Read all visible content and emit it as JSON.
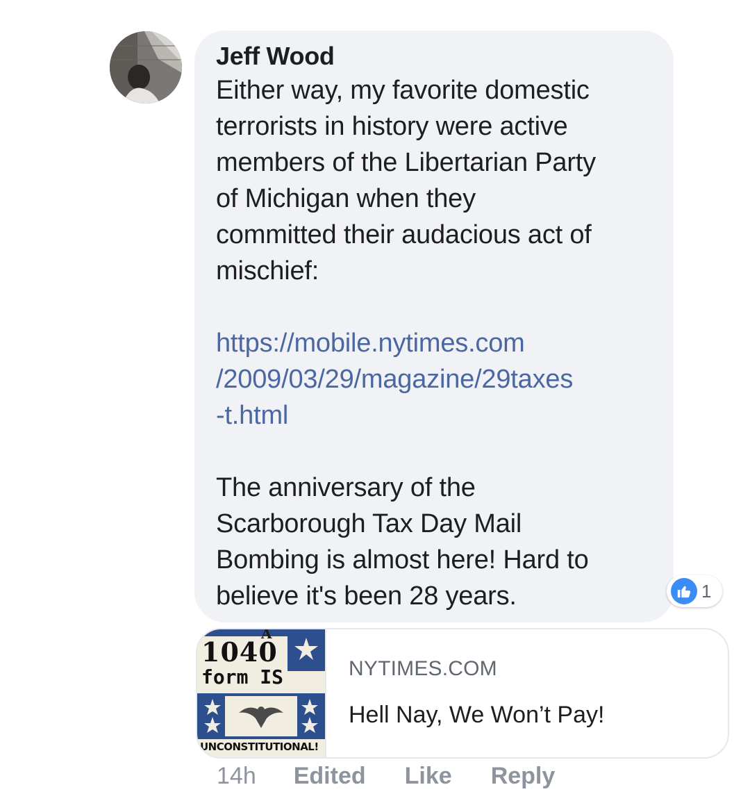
{
  "comment": {
    "author": "Jeff Wood",
    "paragraph_1": "Either way, my favorite domestic\nterrorists in history were active\nmembers of the Libertarian Party\nof Michigan when they\ncommitted their audacious act of\nmischief:",
    "link": "https://mobile.nytimes.com\n/2009/03/29/magazine/29taxes\n-t.html",
    "paragraph_2": "The anniversary of the\nScarborough Tax Day Mail\nBombing is almost here! Hard to\nbelieve it's been 28 years."
  },
  "reactions": {
    "icon": "like-icon",
    "count": "1",
    "color": "#3b8cf4"
  },
  "link_preview": {
    "domain": "NYTIMES.COM",
    "title": "Hell Nay, We Won’t Pay!",
    "thumbnail": {
      "line_1": "1040",
      "line_2": "form IS",
      "line_3": "UNCONSTITUTIONAL!",
      "small_letter": "A"
    }
  },
  "actions": {
    "time": "14h",
    "edited": "Edited",
    "like": "Like",
    "reply": "Reply"
  },
  "colors": {
    "bubble": "#f1f2f5",
    "link": "#4b67a1",
    "muted": "#8d949e",
    "text": "#1c1e21"
  }
}
